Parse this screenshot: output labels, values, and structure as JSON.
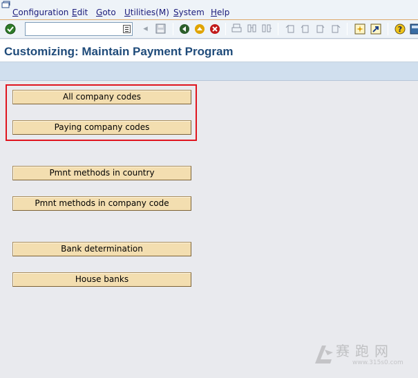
{
  "menubar": {
    "items": [
      {
        "label": "Configuration"
      },
      {
        "label": "Edit"
      },
      {
        "label": "Goto"
      },
      {
        "label": "Utilities(M)"
      },
      {
        "label": "System"
      },
      {
        "label": "Help"
      }
    ]
  },
  "toolbar": {
    "command_field": {
      "value": "",
      "placeholder": ""
    },
    "icons": [
      "enter-icon",
      "back-arrow-icon",
      "save-icon",
      "back-icon",
      "exit-icon",
      "cancel-icon",
      "print-icon",
      "find-icon",
      "find-next-icon",
      "first-page-icon",
      "previous-page-icon",
      "next-page-icon",
      "last-page-icon",
      "create-session-icon",
      "shortcut-icon",
      "help-icon",
      "customize-layout-icon"
    ]
  },
  "title": "Customizing: Maintain Payment Program",
  "buttons": [
    {
      "label": "All company codes"
    },
    {
      "label": "Paying company codes"
    },
    {
      "label": "Pmnt methods in country"
    },
    {
      "label": "Pmnt methods in company code"
    },
    {
      "label": "Bank determination"
    },
    {
      "label": "House banks"
    }
  ],
  "watermark": {
    "text": "赛跑网",
    "url": "www.315s0.com"
  },
  "colors": {
    "button_fill": "#f3deb0",
    "title_text": "#1f4b7a",
    "highlight_box": "#e0141e",
    "app_toolbar": "#d0dfee"
  }
}
